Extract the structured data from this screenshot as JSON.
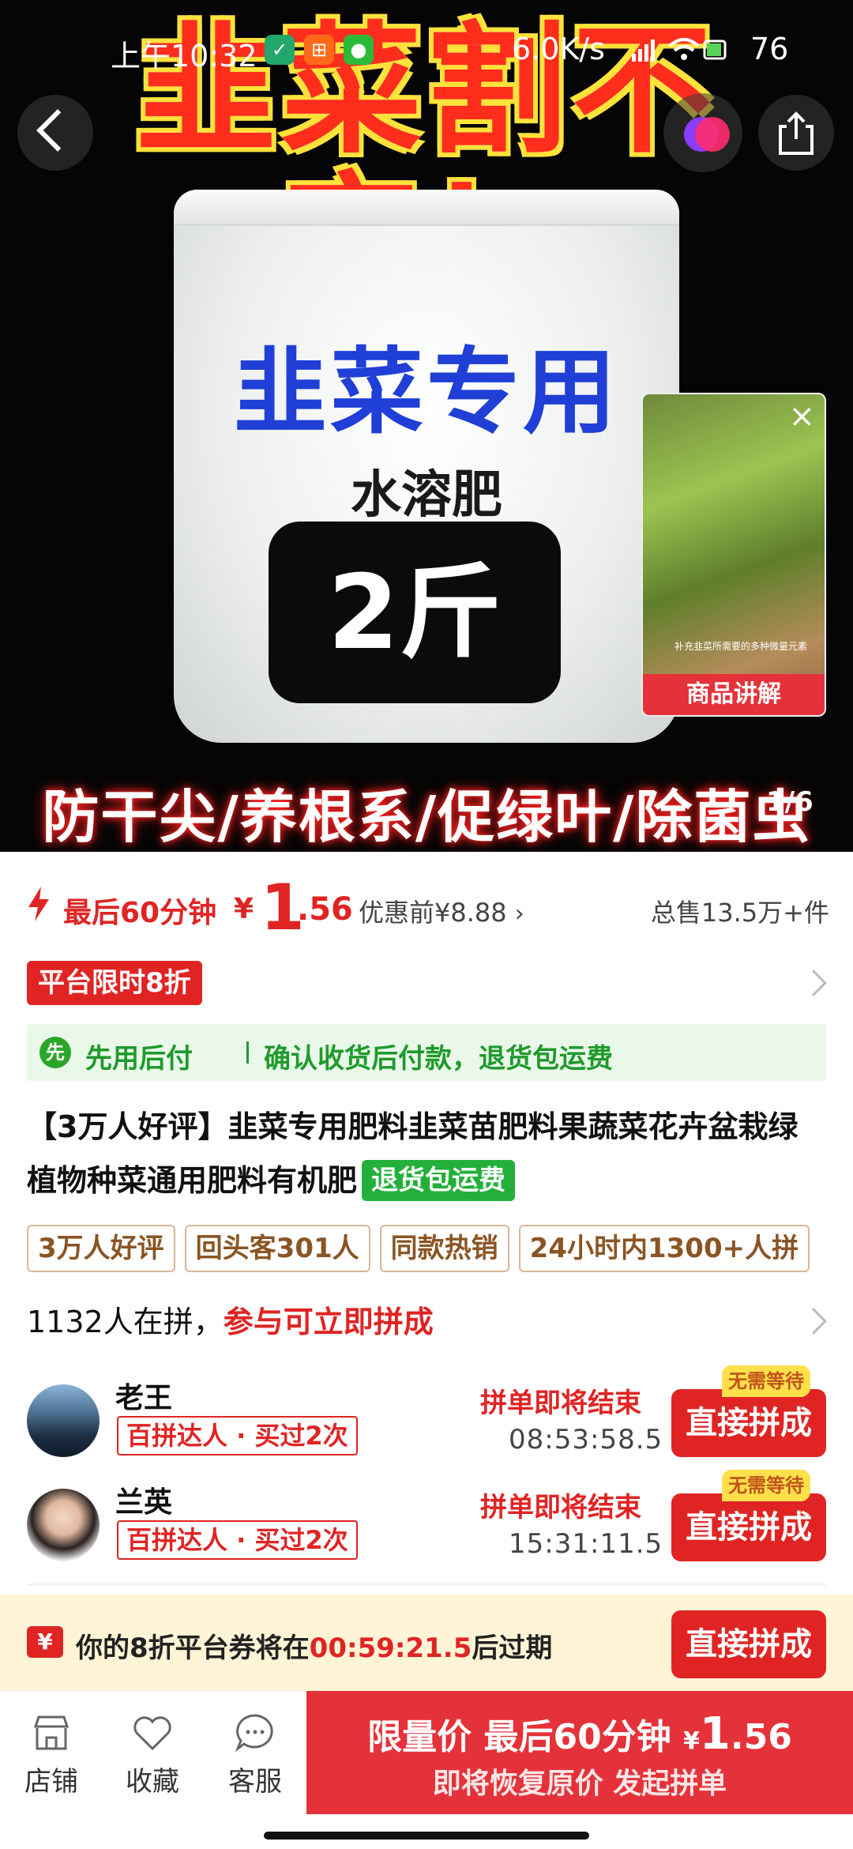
{
  "status_bar": {
    "time": "上午10:32",
    "speed": "6.0K/s",
    "battery": "76"
  },
  "hero": {
    "headline": "韭菜割不完！",
    "bag_title": "韭菜专用",
    "bag_subtitle": "水溶肥",
    "bag_weight": "2斤",
    "bottom_text": "防干尖/养根系/促绿叶/除菌虫",
    "page_indicator": "1/6",
    "video_label": "商品讲解",
    "video_caption": "补充韭菜所需要的多种微量元素",
    "video_close": "×"
  },
  "price": {
    "label": "最后60分钟",
    "currency": "¥",
    "integer": "1",
    "decimal": ".56",
    "original": "优惠前¥8.88",
    "sold": "总售13.5万+件"
  },
  "promo_tag": "平台限时8折",
  "payline": {
    "badge": "先",
    "title": "先用后付",
    "detail": "确认收货后付款，退货包运费"
  },
  "product": {
    "title": "【3万人好评】韭菜专用肥料韭菜苗肥料果蔬菜花卉盆栽绿植物种菜通用肥料有机肥",
    "refund_badge": "退货包运费"
  },
  "tags": [
    "3万人好评",
    "回头客301人",
    "同款热销",
    "24小时内1300+人拼"
  ],
  "group": {
    "count_text": "1132人在拼，",
    "highlight": "参与可立即拼成",
    "rows": [
      {
        "name": "老王",
        "badge": "百拼达人 · 买过2次",
        "ending": "拼单即将结束",
        "countdown": "08:53:58.5",
        "button": "直接拼成",
        "wait": "无需等待"
      },
      {
        "name": "兰英",
        "badge": "百拼达人 · 买过2次",
        "ending": "拼单即将结束",
        "countdown": "15:31:11.5",
        "button": "直接拼成",
        "wait": "无需等待"
      }
    ]
  },
  "coupon": {
    "icon": "¥",
    "text_before": "你的8折平台券将在",
    "time": "00:59:21.5",
    "text_after": "后过期",
    "button": "直接拼成"
  },
  "bottom_nav": {
    "store": "店铺",
    "favorite": "收藏",
    "service": "客服"
  },
  "cta": {
    "line1_prefix": "限量价  最后60分钟 ",
    "currency": "¥",
    "integer": "1",
    "decimal": ".56",
    "line2": "即将恢复原价 发起拼单"
  },
  "colors": {
    "accent": "#e02424",
    "green": "#1f9a2c",
    "cta": "#e5323a",
    "coupon_bg": "#fff4d6"
  }
}
